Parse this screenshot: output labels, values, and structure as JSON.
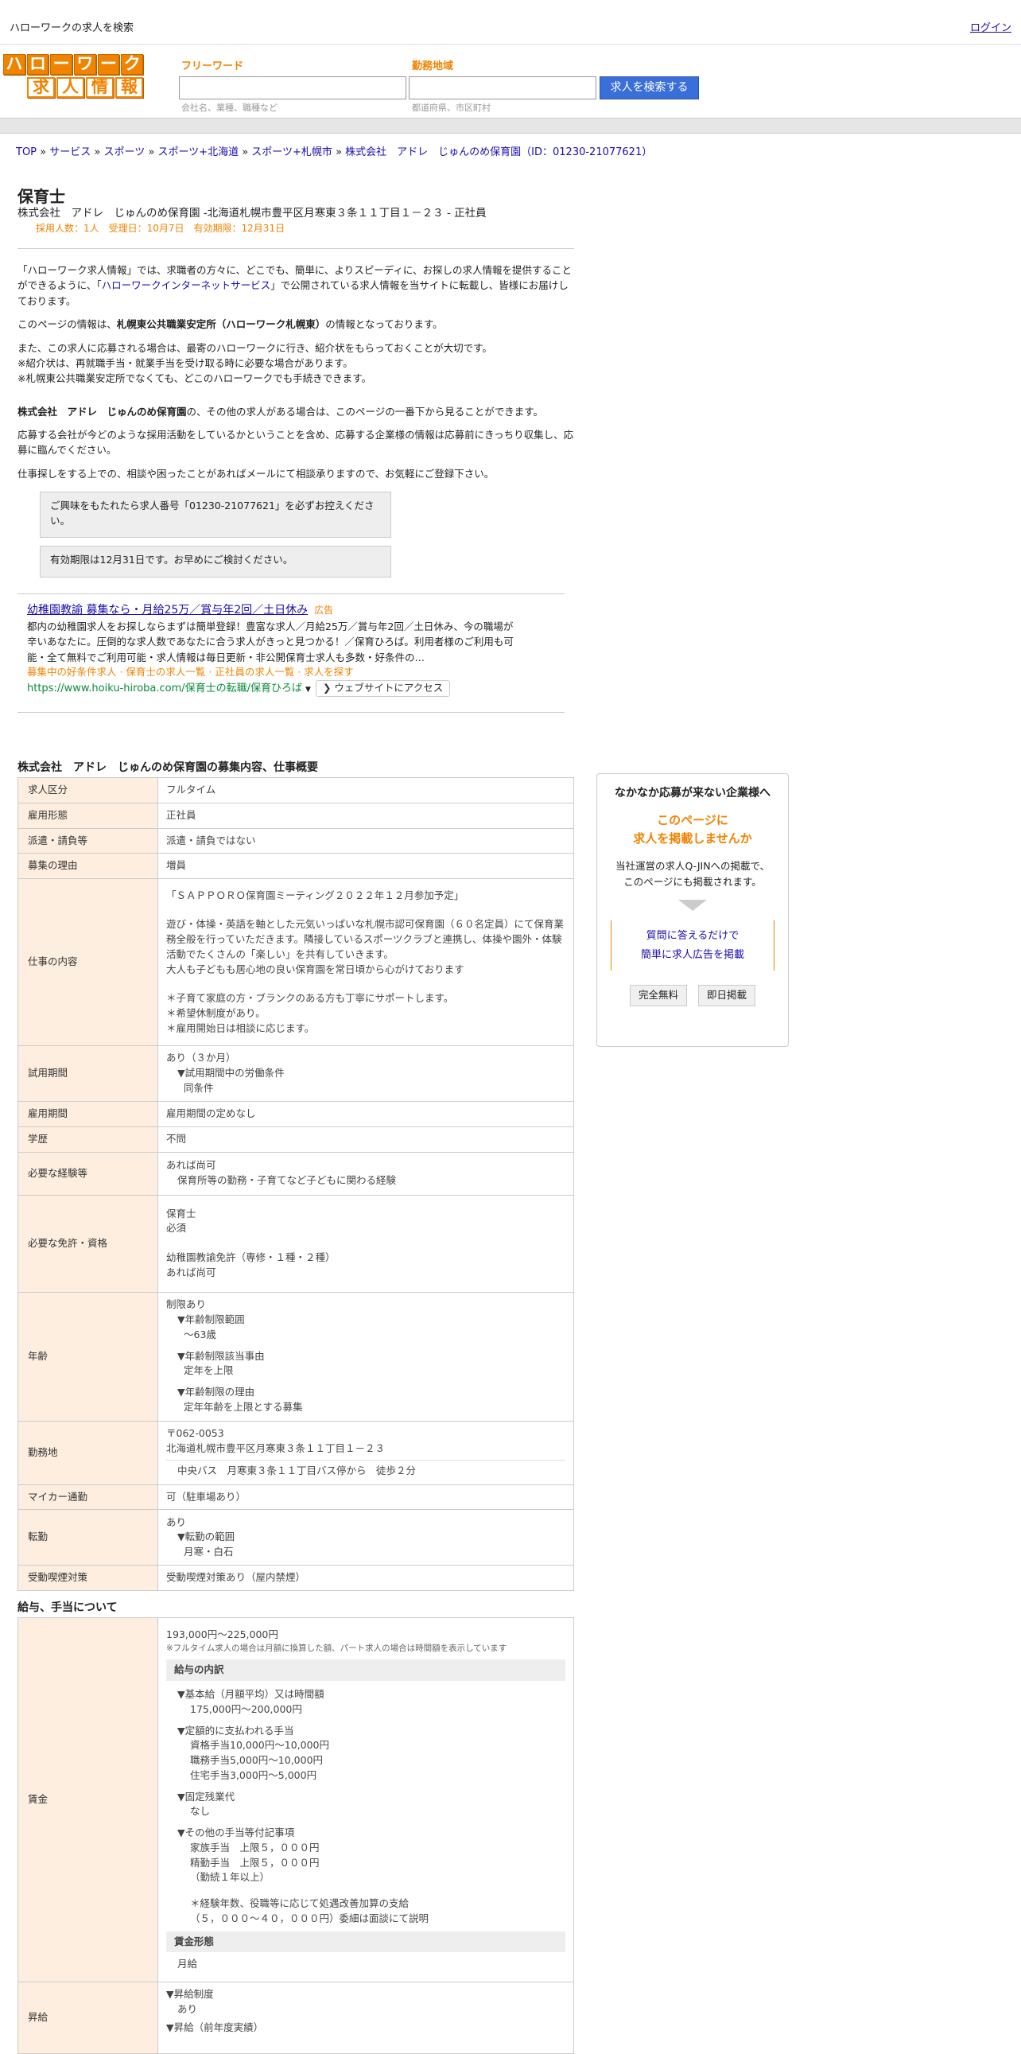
{
  "topbar": {
    "title": "ハローワークの求人を検索",
    "login": "ログイン"
  },
  "logo": {
    "row1": [
      "ハ",
      "ロ",
      "ー",
      "ワ",
      "ー",
      "ク"
    ],
    "row2": [
      "求",
      "人",
      "情",
      "報"
    ]
  },
  "search": {
    "keyword_label": "フリーワード",
    "keyword_hint": "会社名、業種、職種など",
    "area_label": "勤務地域",
    "area_hint": "都道府県、市区町村",
    "button": "求人を検索する"
  },
  "breadcrumb": [
    "TOP",
    "サービス",
    "スポーツ",
    "スポーツ+北海道",
    "スポーツ+札幌市",
    "株式会社　アドレ　じゅんのめ保育園（ID：01230-21077621）"
  ],
  "job": {
    "title": "保育士",
    "subtitle": "株式会社　アドレ　じゅんのめ保育園 -北海道札幌市豊平区月寒東３条１１丁目１－２３ - 正社員",
    "meta": "採用人数：1人　受理日：10月7日　有効期限：12月31日"
  },
  "intro": {
    "p1a": "「ハローワーク求人情報」では、求職者の方々に、どこでも、簡単に、よりスピーディに、お探しの求人情報を提供することができるように、「",
    "p1link": "ハローワークインターネットサービス",
    "p1b": "」で公開されている求人情報を当サイトに転載し、皆様にお届けしております。",
    "p2a": "このページの情報は、",
    "p2b": "札幌東公共職業安定所（ハローワーク札幌東）",
    "p2c": "の情報となっております。",
    "p3": [
      "また、この求人に応募される場合は、最寄のハローワークに行き、紹介状をもらっておくことが大切です。",
      "※紹介状は、再就職手当・就業手当を受け取る時に必要な場合があります。",
      "※札幌東公共職業安定所でなくても、どこのハローワークでも手続きできます。"
    ],
    "p4a": "株式会社　アドレ　じゅんのめ保育園",
    "p4b": "の、その他の求人がある場合は、このページの一番下から見ることができます。",
    "p5": "応募する会社が今どのような採用活動をしているかということを含め、応募する企業様の情報は応募前にきっちり収集し、応募に臨んでください。",
    "p6": "仕事探しをする上での、相談や困ったことがあればメールにて相談承りますので、お気軽にご登録下さい。"
  },
  "notes": [
    "ご興味をもたれたら求人番号「01230-21077621」を必ずお控えください。",
    "有効期限は12月31日です。お早めにご検討ください。"
  ],
  "ad": {
    "title": "幼稚園教諭 募集なら・月給25万／賞与年2回／土日休み",
    "tag": "広告",
    "desc": "都内の幼稚園求人をお探しならまずは簡単登録！豊富な求人／月給25万／賞与年2回／土日休み、今の職場が辛いあなたに。圧倒的な求人数であなたに合う求人がきっと見つかる！／保育ひろば。利用者様のご利用も可能・全て無料でご利用可能・求人情報は毎日更新・非公開保育士求人も多数・好条件の…",
    "links": "募集中の好条件求人 · 保育士の求人一覧 · 正社員の求人一覧 · 求人を探す",
    "url": "https://www.hoiku-hiroba.com/保育士の転職/保育ひろば",
    "visit": "ウェブサイトにアクセス"
  },
  "section1": "株式会社　アドレ　じゅんのめ保育園の募集内容、仕事概要",
  "rows": {
    "kubun": {
      "k": "求人区分",
      "v": "フルタイム"
    },
    "koyo": {
      "k": "雇用形態",
      "v": "正社員"
    },
    "haken": {
      "k": "派遣・請負等",
      "v": "派遣・請負ではない"
    },
    "riyu": {
      "k": "募集の理由",
      "v": "増員"
    },
    "naiyo": {
      "k": "仕事の内容",
      "v": [
        "「ＳＡＰＰＯＲＯ保育園ミーティング２０２２年１２月参加予定」",
        "",
        "遊び・体操・英語を軸とした元気いっぱいな札幌市認可保育園（６０名定員）にて保育業務全般を行っていただきます。隣接しているスポーツクラブと連携し、体操や園外・体験活動でたくさんの「楽しい」を共有していきます。",
        "大人も子どもも居心地の良い保育園を常日頃から心がけております",
        "",
        "＊子育て家庭の方・ブランクのある方も丁寧にサポートします。",
        "＊希望休制度があり。",
        "＊雇用開始日は相談に応じます。"
      ]
    },
    "shiyo": {
      "k": "試用期間",
      "v1": "あり（３か月）",
      "v2": "▼試用期間中の労働条件",
      "v3": "同条件"
    },
    "kikan": {
      "k": "雇用期間",
      "v": "雇用期間の定めなし"
    },
    "gakureki": {
      "k": "学歴",
      "v": "不問"
    },
    "keiken": {
      "k": "必要な経験等",
      "v1": "あれば尚可",
      "v2": "保育所等の勤務・子育てなど子どもに関わる経験"
    },
    "menkyo": {
      "k": "必要な免許・資格",
      "v": [
        "保育士",
        "必須",
        "",
        "幼稚園教諭免許（専修・１種・２種）",
        "あれば尚可"
      ]
    },
    "nenrei": {
      "k": "年齢",
      "v0": "制限あり",
      "a1": "▼年齢制限範囲",
      "a2": "〜63歳",
      "b1": "▼年齢制限該当事由",
      "b2": "定年を上限",
      "c1": "▼年齢制限の理由",
      "c2": "定年年齢を上限とする募集"
    },
    "kinmu": {
      "k": "勤務地",
      "v1": "〒062-0053",
      "v2": "北海道札幌市豊平区月寒東３条１１丁目１－２３",
      "v3": "中央バス　月寒東３条１１丁目バス停から　徒歩２分"
    },
    "mycar": {
      "k": "マイカー通勤",
      "v": "可（駐車場あり）"
    },
    "tenkin": {
      "k": "転勤",
      "v1": "あり",
      "v2": "▼転勤の範囲",
      "v3": "月寒・白石"
    },
    "kitsuen": {
      "k": "受動喫煙対策",
      "v": "受動喫煙対策あり（屋内禁煙）"
    }
  },
  "section2": "給与、手当について",
  "wage": {
    "k": "賃金",
    "range": "193,000円〜225,000円",
    "note": "※フルタイム求人の場合は月額に換算した額、パート求人の場合は時間額を表示しています",
    "breakdown_h": "給与の内訳",
    "base1": "▼基本給（月額平均）又は時間額",
    "base2": "175,000円〜200,000円",
    "fixed1": "▼定額的に支払われる手当",
    "fixed2": "資格手当10,000円〜10,000円",
    "fixed3": "職務手当5,000円〜10,000円",
    "fixed4": "住宅手当3,000円〜5,000円",
    "ot1": "▼固定残業代",
    "ot2": "なし",
    "other1": "▼その他の手当等付記事項",
    "other2": "家族手当　上限５，０００円",
    "other3": "精勤手当　上限５，０００円",
    "other4": "（勤続１年以上）",
    "other5": "＊経験年数、役職等に応じて処遇改善加算の支給",
    "other6": "（５，０００〜４０，０００円）委細は面談にて説明",
    "form_h": "賃金形態",
    "form": "月給"
  },
  "raise": {
    "k": "昇給",
    "v1": "▼昇給制度",
    "v2": "あり",
    "v3": "▼昇給（前年度実績）"
  },
  "side": {
    "h": "なかなか応募が来ない企業様へ",
    "o1": "このページに",
    "o2": "求人を掲載しませんか",
    "d1": "当社運営の求人Q-JINへの掲載で、",
    "d2": "このページにも掲載されます。",
    "l1": "質問に答えるだけで",
    "l2": "簡単に求人広告を掲載",
    "b1": "完全無料",
    "b2": "即日掲載"
  }
}
